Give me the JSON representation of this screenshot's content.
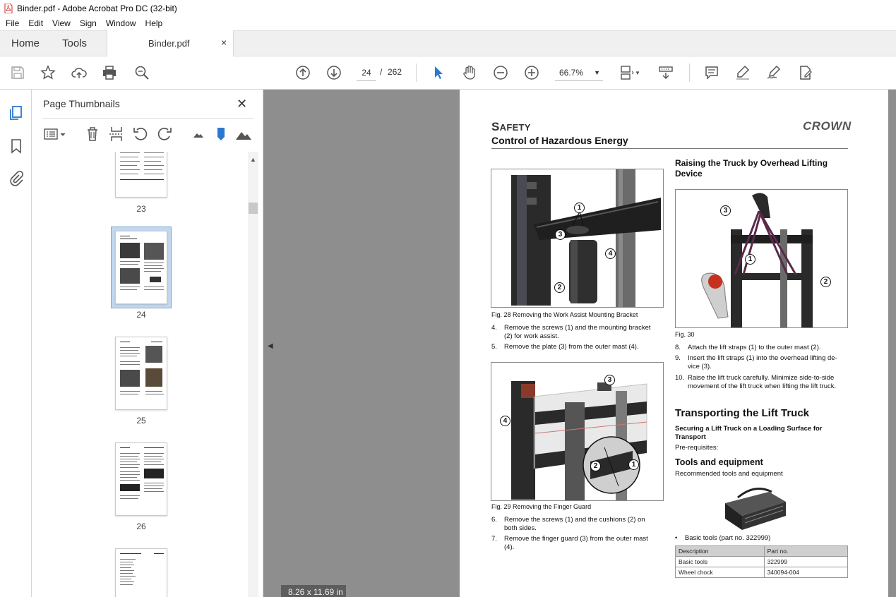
{
  "window": {
    "title": "Binder.pdf - Adobe Acrobat Pro DC (32-bit)"
  },
  "menu": [
    "File",
    "Edit",
    "View",
    "Sign",
    "Window",
    "Help"
  ],
  "tabs": {
    "home": "Home",
    "tools": "Tools",
    "document": "Binder.pdf",
    "close": "×"
  },
  "toolbar": {
    "page_current": "24",
    "page_sep": "/",
    "page_total": "262",
    "zoom": "66.7%"
  },
  "thumbnails": {
    "title": "Page Thumbnails",
    "close": "✕",
    "items": [
      {
        "label": "23"
      },
      {
        "label": "24"
      },
      {
        "label": "25"
      },
      {
        "label": "26"
      }
    ]
  },
  "status": {
    "page_size": "8.26 x 11.69 in"
  },
  "page": {
    "section": "Safety",
    "subsection": "Control of Hazardous Energy",
    "logo": "CROWN",
    "fig28": {
      "caption": "Fig. 28  Removing the Work Assist Mounting Bracket",
      "callouts": [
        "1",
        "3",
        "4",
        "2"
      ]
    },
    "steps_a": [
      {
        "n": "4.",
        "t1": "Remove the screws (1) and the mounting bracket",
        "t2": "(2) for work assist."
      },
      {
        "n": "5.",
        "t1": "Remove the plate (3) from the outer mast (4).",
        "t2": ""
      }
    ],
    "fig29": {
      "caption": "Fig. 29  Removing the Finger Guard",
      "callouts": [
        "3",
        "4",
        "2",
        "1"
      ]
    },
    "steps_b": [
      {
        "n": "6.",
        "t1": "Remove the screws (1) and the cushions (2) on",
        "t2": "both sides."
      },
      {
        "n": "7.",
        "t1": "Remove the finger guard (3) from the outer mast",
        "t2": "(4)."
      }
    ],
    "raising": {
      "heading_1": "Raising the Truck by Overhead Lifting",
      "heading_2": "Device"
    },
    "fig30": {
      "caption": "Fig. 30",
      "callouts": [
        "3",
        "1",
        "2"
      ]
    },
    "steps_c": [
      {
        "n": "8.",
        "t1": "Attach the lift straps (1) to the outer mast (2).",
        "t2": ""
      },
      {
        "n": "9.",
        "t1": "Insert the lift straps (1) into the overhead lifting de-",
        "t2": "vice (3)."
      },
      {
        "n": "10.",
        "t1": "Raise the lift truck carefully. Minimize side-to-side",
        "t2": "movement of the lift truck when lifting the lift truck."
      }
    ],
    "transport": {
      "heading": "Transporting the Lift Truck",
      "sub_1": "Securing a Lift Truck on a Loading Surface for",
      "sub_2": "Transport",
      "prereq": "Pre-requisites:",
      "tools_heading": "Tools and equipment",
      "tools_text": "Recommended tools and equipment",
      "bullet": "Basic tools (part no. 322999)",
      "table": {
        "headers": [
          "Description",
          "Part no."
        ],
        "rows": [
          [
            "Basic tools",
            "322999"
          ],
          [
            "Wheel chock",
            "340094-004"
          ]
        ]
      }
    }
  }
}
